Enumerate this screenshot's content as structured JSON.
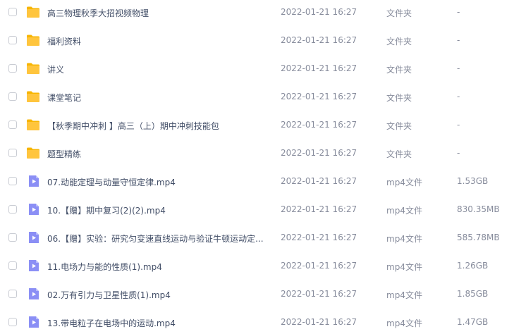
{
  "files": [
    {
      "name": "高三物理秋季大招视频物理",
      "date": "2022-01-21 16:27",
      "type": "文件夹",
      "size": "-",
      "icon": "folder-icon"
    },
    {
      "name": "福利资料",
      "date": "2022-01-21 16:27",
      "type": "文件夹",
      "size": "-",
      "icon": "folder-icon"
    },
    {
      "name": "讲义",
      "date": "2022-01-21 16:27",
      "type": "文件夹",
      "size": "-",
      "icon": "folder-icon"
    },
    {
      "name": "课堂笔记",
      "date": "2022-01-21 16:27",
      "type": "文件夹",
      "size": "-",
      "icon": "folder-icon"
    },
    {
      "name": "【秋季期中冲刺 】高三（上）期中冲刺技能包",
      "date": "2022-01-21 16:27",
      "type": "文件夹",
      "size": "-",
      "icon": "folder-icon"
    },
    {
      "name": "题型精练",
      "date": "2022-01-21 16:27",
      "type": "文件夹",
      "size": "-",
      "icon": "folder-icon"
    },
    {
      "name": "07.动能定理与动量守恒定律.mp4",
      "date": "2022-01-21 16:27",
      "type": "mp4文件",
      "size": "1.53GB",
      "icon": "video-file-icon"
    },
    {
      "name": "10.【赠】期中复习(2)(2).mp4",
      "date": "2022-01-21 16:27",
      "type": "mp4文件",
      "size": "830.35MB",
      "icon": "video-file-icon"
    },
    {
      "name": "06.【赠】实验：研究匀变速直线运动与验证牛顿运动定...",
      "date": "2022-01-21 16:27",
      "type": "mp4文件",
      "size": "585.78MB",
      "icon": "video-file-icon"
    },
    {
      "name": "11.电场力与能的性质(1).mp4",
      "date": "2022-01-21 16:27",
      "type": "mp4文件",
      "size": "1.26GB",
      "icon": "video-file-icon"
    },
    {
      "name": "02.万有引力与卫星性质(1).mp4",
      "date": "2022-01-21 16:27",
      "type": "mp4文件",
      "size": "1.85GB",
      "icon": "video-file-icon"
    },
    {
      "name": "13.带电粒子在电场中的运动.mp4",
      "date": "2022-01-21 16:27",
      "type": "mp4文件",
      "size": "1.47GB",
      "icon": "video-file-icon"
    }
  ],
  "colors": {
    "folder": "#ffc53d",
    "folder_tab": "#f7b500",
    "video": "#8b8ff5",
    "video_fold": "#b8bbfa"
  }
}
